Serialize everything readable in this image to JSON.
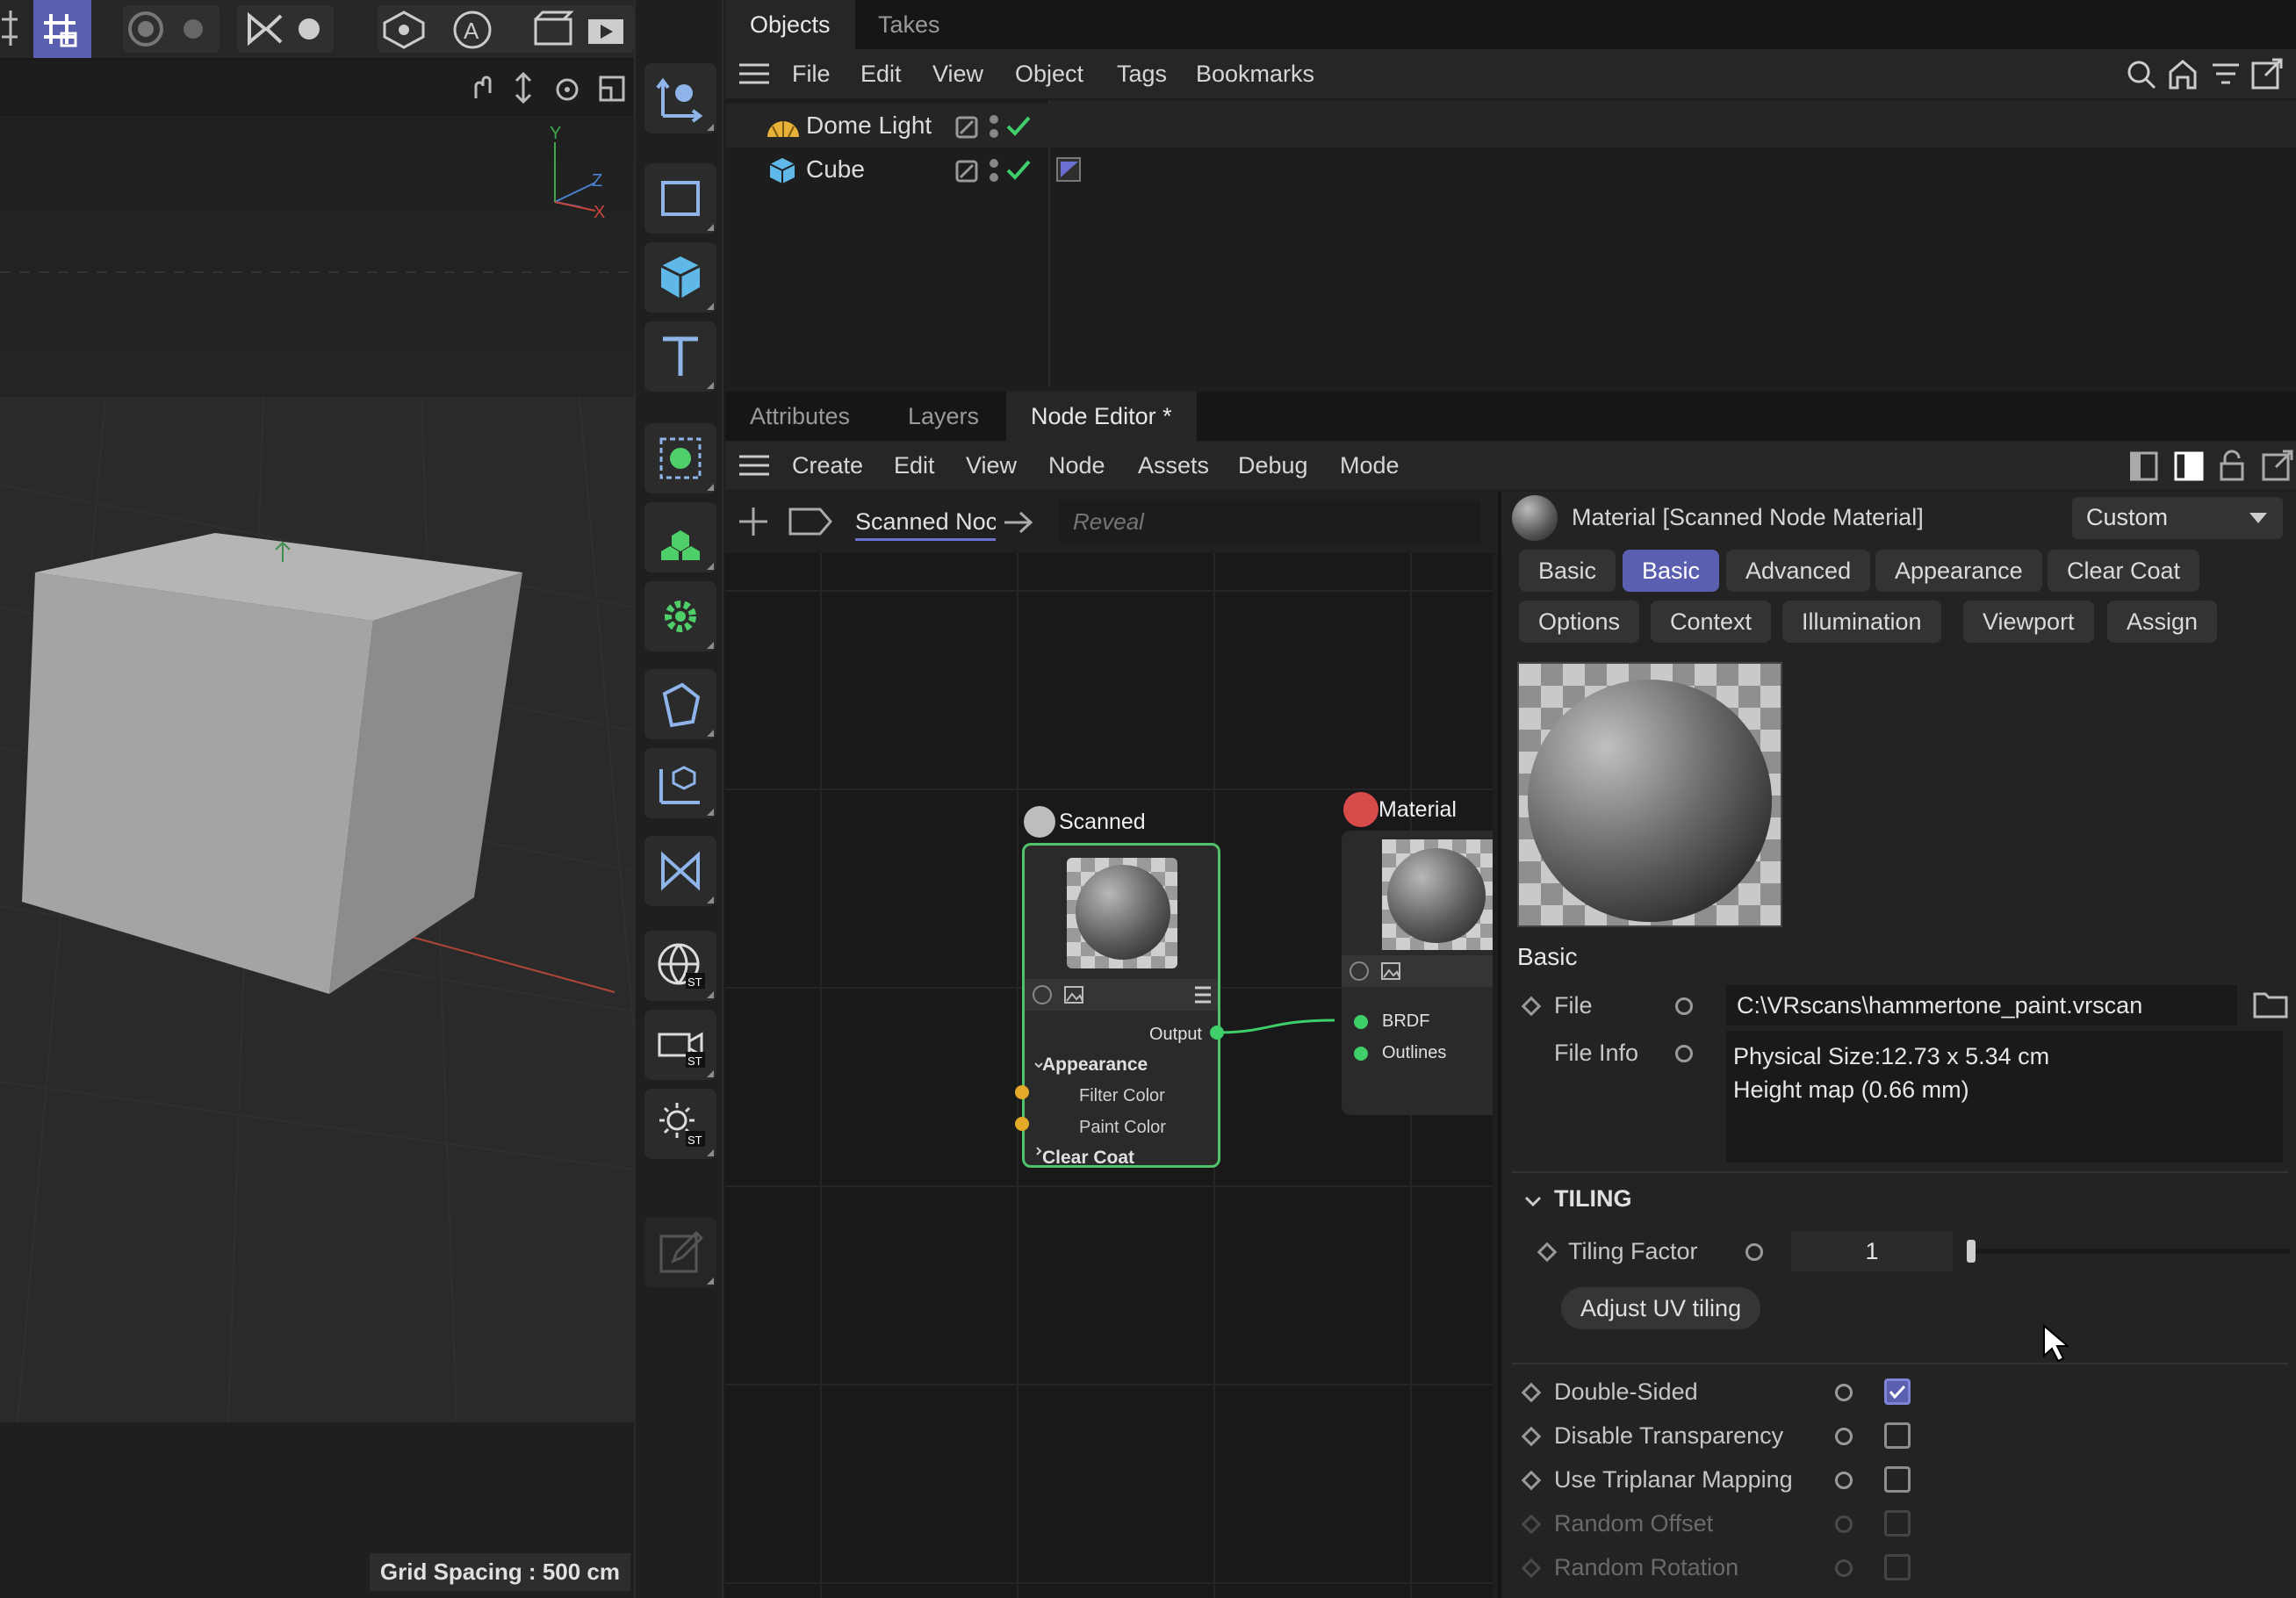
{
  "viewport": {
    "grid_spacing": "Grid Spacing : 500 cm",
    "axis_labels": {
      "y": "Y",
      "z": "Z",
      "x": "X"
    }
  },
  "objects_panel": {
    "tabs": [
      "Objects",
      "Takes"
    ],
    "menu": [
      "File",
      "Edit",
      "View",
      "Object",
      "Tags",
      "Bookmarks"
    ],
    "objects": [
      {
        "name": "Dome Light",
        "icon": "dome-light-icon",
        "color": "#e8b13a"
      },
      {
        "name": "Cube",
        "icon": "cube-icon",
        "color": "#5fb8e8"
      }
    ]
  },
  "lower_tabs": [
    "Attributes",
    "Layers",
    "Node Editor *"
  ],
  "node_editor": {
    "menu": [
      "Create",
      "Edit",
      "View",
      "Node",
      "Assets",
      "Debug",
      "Mode"
    ],
    "breadcrumb": "Scanned Noc",
    "search_placeholder": "Reveal",
    "nodes": {
      "scanned": {
        "title": "Scanned",
        "output": "Output",
        "group_appearance": "Appearance",
        "filter_color": "Filter Color",
        "paint_color": "Paint Color",
        "group_clear_coat": "Clear Coat"
      },
      "material": {
        "title": "Material",
        "brdf": "BRDF",
        "outlines": "Outlines"
      }
    }
  },
  "attributes": {
    "header_title": "Material [Scanned Node Material]",
    "mode_dropdown": "Custom",
    "tabs_row1": [
      "Basic",
      "Basic",
      "Advanced",
      "Appearance",
      "Clear Coat"
    ],
    "active_tab_index": 1,
    "tabs_row2": [
      "Options",
      "Context",
      "Illumination",
      "Viewport",
      "Assign"
    ],
    "section_basic": "Basic",
    "file_label": "File",
    "file_value": "C:\\VRscans\\hammertone_paint.vrscan",
    "file_info_label": "File Info",
    "file_info_line1": "Physical Size:12.73 x 5.34 cm",
    "file_info_line2": "Height map (0.66 mm)",
    "tiling_header": "TILING",
    "tiling_factor_label": "Tiling Factor",
    "tiling_factor_value": "1",
    "adjust_uv_button": "Adjust UV tiling",
    "checkboxes": [
      {
        "label": "Double-Sided",
        "checked": true,
        "enabled": true
      },
      {
        "label": "Disable Transparency",
        "checked": false,
        "enabled": true
      },
      {
        "label": "Use Triplanar Mapping",
        "checked": false,
        "enabled": true
      },
      {
        "label": "Random Offset",
        "checked": false,
        "enabled": false
      },
      {
        "label": "Random Rotation",
        "checked": false,
        "enabled": false
      }
    ]
  },
  "colors": {
    "accent": "#5a5fb0",
    "node_border_green": "#4fc26a",
    "connection_green": "#3fcf6a",
    "port_yellow": "#e5a92a",
    "check_green": "#3fcf6a"
  }
}
